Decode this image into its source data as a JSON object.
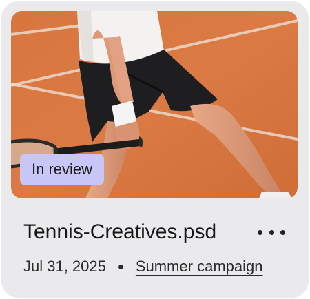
{
  "card": {
    "status_badge": "In review",
    "file_name": "Tennis-Creatives.psd",
    "date": "Jul 31, 2025",
    "campaign": "Summer campaign",
    "more_icon": "more-horizontal-icon"
  },
  "colors": {
    "card_bg": "#eae9ec",
    "badge_bg": "#c7c6f7",
    "court_clay": "#d9763f",
    "text_primary": "#161616"
  }
}
